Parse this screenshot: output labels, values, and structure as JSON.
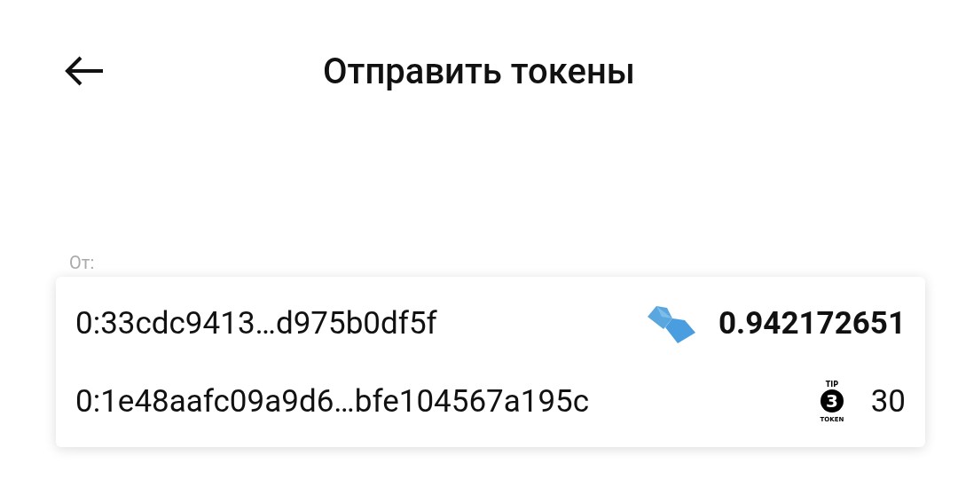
{
  "header": {
    "title": "Отправить токены"
  },
  "from": {
    "label": "От:",
    "accounts": [
      {
        "address": "0:33cdc9413…d975b0df5f",
        "kind": "crystal",
        "balance": "0.942172651",
        "selected": true
      },
      {
        "address": "0:1e48aafc09a9d6…bfe104567a195c",
        "kind": "tip3",
        "logo": {
          "top": "TIP",
          "digit": "3",
          "bottom": "TOKEN"
        },
        "balance": "30",
        "selected": false
      }
    ]
  }
}
